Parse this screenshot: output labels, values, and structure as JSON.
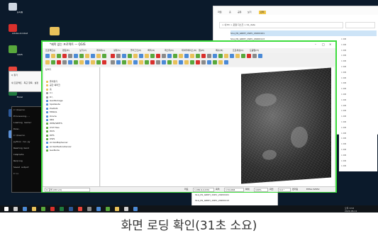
{
  "caption": "화면 로딩 확인(31초 소요)",
  "desktop": {
    "icons": [
      {
        "label": "휴지통",
        "color": "#cfd8e3"
      },
      {
        "label": "Adobe Acrobat",
        "color": "#d9302c"
      },
      {
        "label": "QGIS",
        "color": "#58a83c"
      },
      {
        "label": "Chrome",
        "color": "#e8443a"
      },
      {
        "label": "Excel",
        "color": "#1f7a3e"
      },
      {
        "label": "Word",
        "color": "#2b5797"
      },
      {
        "label": "Notepad",
        "color": "#5a8fd6"
      }
    ],
    "folder_color": "#e8c15a"
  },
  "explorer": {
    "tabs": [
      "파일",
      "홈",
      "공유",
      "보기",
      "관리"
    ],
    "address": "> 내 PC > 로컬 디스크 > S1_data",
    "rows": [
      "S1A_IW_GRDH_1SDV_20200101",
      "S1A_IW_GRDH_1SDV_20200113",
      "S1A_IW_GRDH_1SDV_20200125",
      "S1A_IW_GRDH_1SDV_20200206",
      "S1A_IW_GRDH_1SDV_20200218"
    ]
  },
  "right_list": [
    "1 KB",
    "1 KB",
    "1 KB",
    "1 KB",
    "1 KB",
    "1 KB",
    "1 KB",
    "1 KB",
    "1 KB",
    "1 KB",
    "1 KB",
    "1 KB",
    "1 KB",
    "1 KB",
    "1 KB",
    "1 KB",
    "1 KB",
    "1 KB",
    "1 KB",
    "1 KB",
    "1 KB",
    "1 KB",
    "1 KB",
    "1 KB"
  ],
  "cmd_lines": [
    "C:\\Users>",
    "Processing...",
    "Loading raster",
    "Done.",
    "C:\\Users>",
    "python run.py",
    "Reading band",
    "Complete",
    "Warping",
    "Saved output",
    "C:\\>"
  ],
  "small_win": {
    "row1": "Q 찾기",
    "row2": "새 프로젝트 · 최근 항목 · 설정"
  },
  "qgis": {
    "title": "*제목 없는 프로젝트 — QGIS",
    "menus": [
      "프로젝트(J)",
      "편집(E)",
      "보기(V)",
      "레이어(L)",
      "설정(S)",
      "플러그인(P)",
      "벡터(O)",
      "래스터(R)",
      "데이터베이스(D)",
      "웹(W)",
      "메쉬(M)",
      "프로세싱(C)",
      "도움말(H)"
    ],
    "browser_title": "탐색기",
    "tree": [
      "즐겨찾기",
      "공간 북마크",
      "홈",
      "C:\\",
      "D:\\",
      "GeoPackage",
      "SpatiaLite",
      "PostGIS",
      "MSSQL",
      "Oracle",
      "DB2",
      "WMS/WMTS",
      "XYZ Tiles",
      "WCS",
      "WFS",
      "OWS",
      "ArcGisMapServer",
      "ArcGisFeatureServer",
      "GeoNode"
    ],
    "tree_colors": [
      "#e8c15a",
      "#e8c15a",
      "#e8c15a",
      "#999999",
      "#999999",
      "#4b8ad6",
      "#4b8ad6",
      "#4b8ad6",
      "#4b8ad6",
      "#4b8ad6",
      "#4b8ad6",
      "#58a83c",
      "#58a83c",
      "#58a83c",
      "#58a83c",
      "#58a83c",
      "#4b8ad6",
      "#4b8ad6",
      "#58a83c"
    ],
    "status": {
      "locate": "Q 검색 (Ctrl+K)",
      "coord_label": "좌표",
      "coord": "1,082,4,2,034",
      "scale_label": "축척",
      "scale": "1:54,994",
      "magnifier_label": "확대",
      "magnifier": "100%",
      "rotation_label": "회전",
      "rotation": "0.0 °",
      "render": "렌더링",
      "crs": "EPSG:32652"
    }
  },
  "taskbar": {
    "tray_time": "오후 3:53",
    "tray_date": "2020-06-11"
  }
}
